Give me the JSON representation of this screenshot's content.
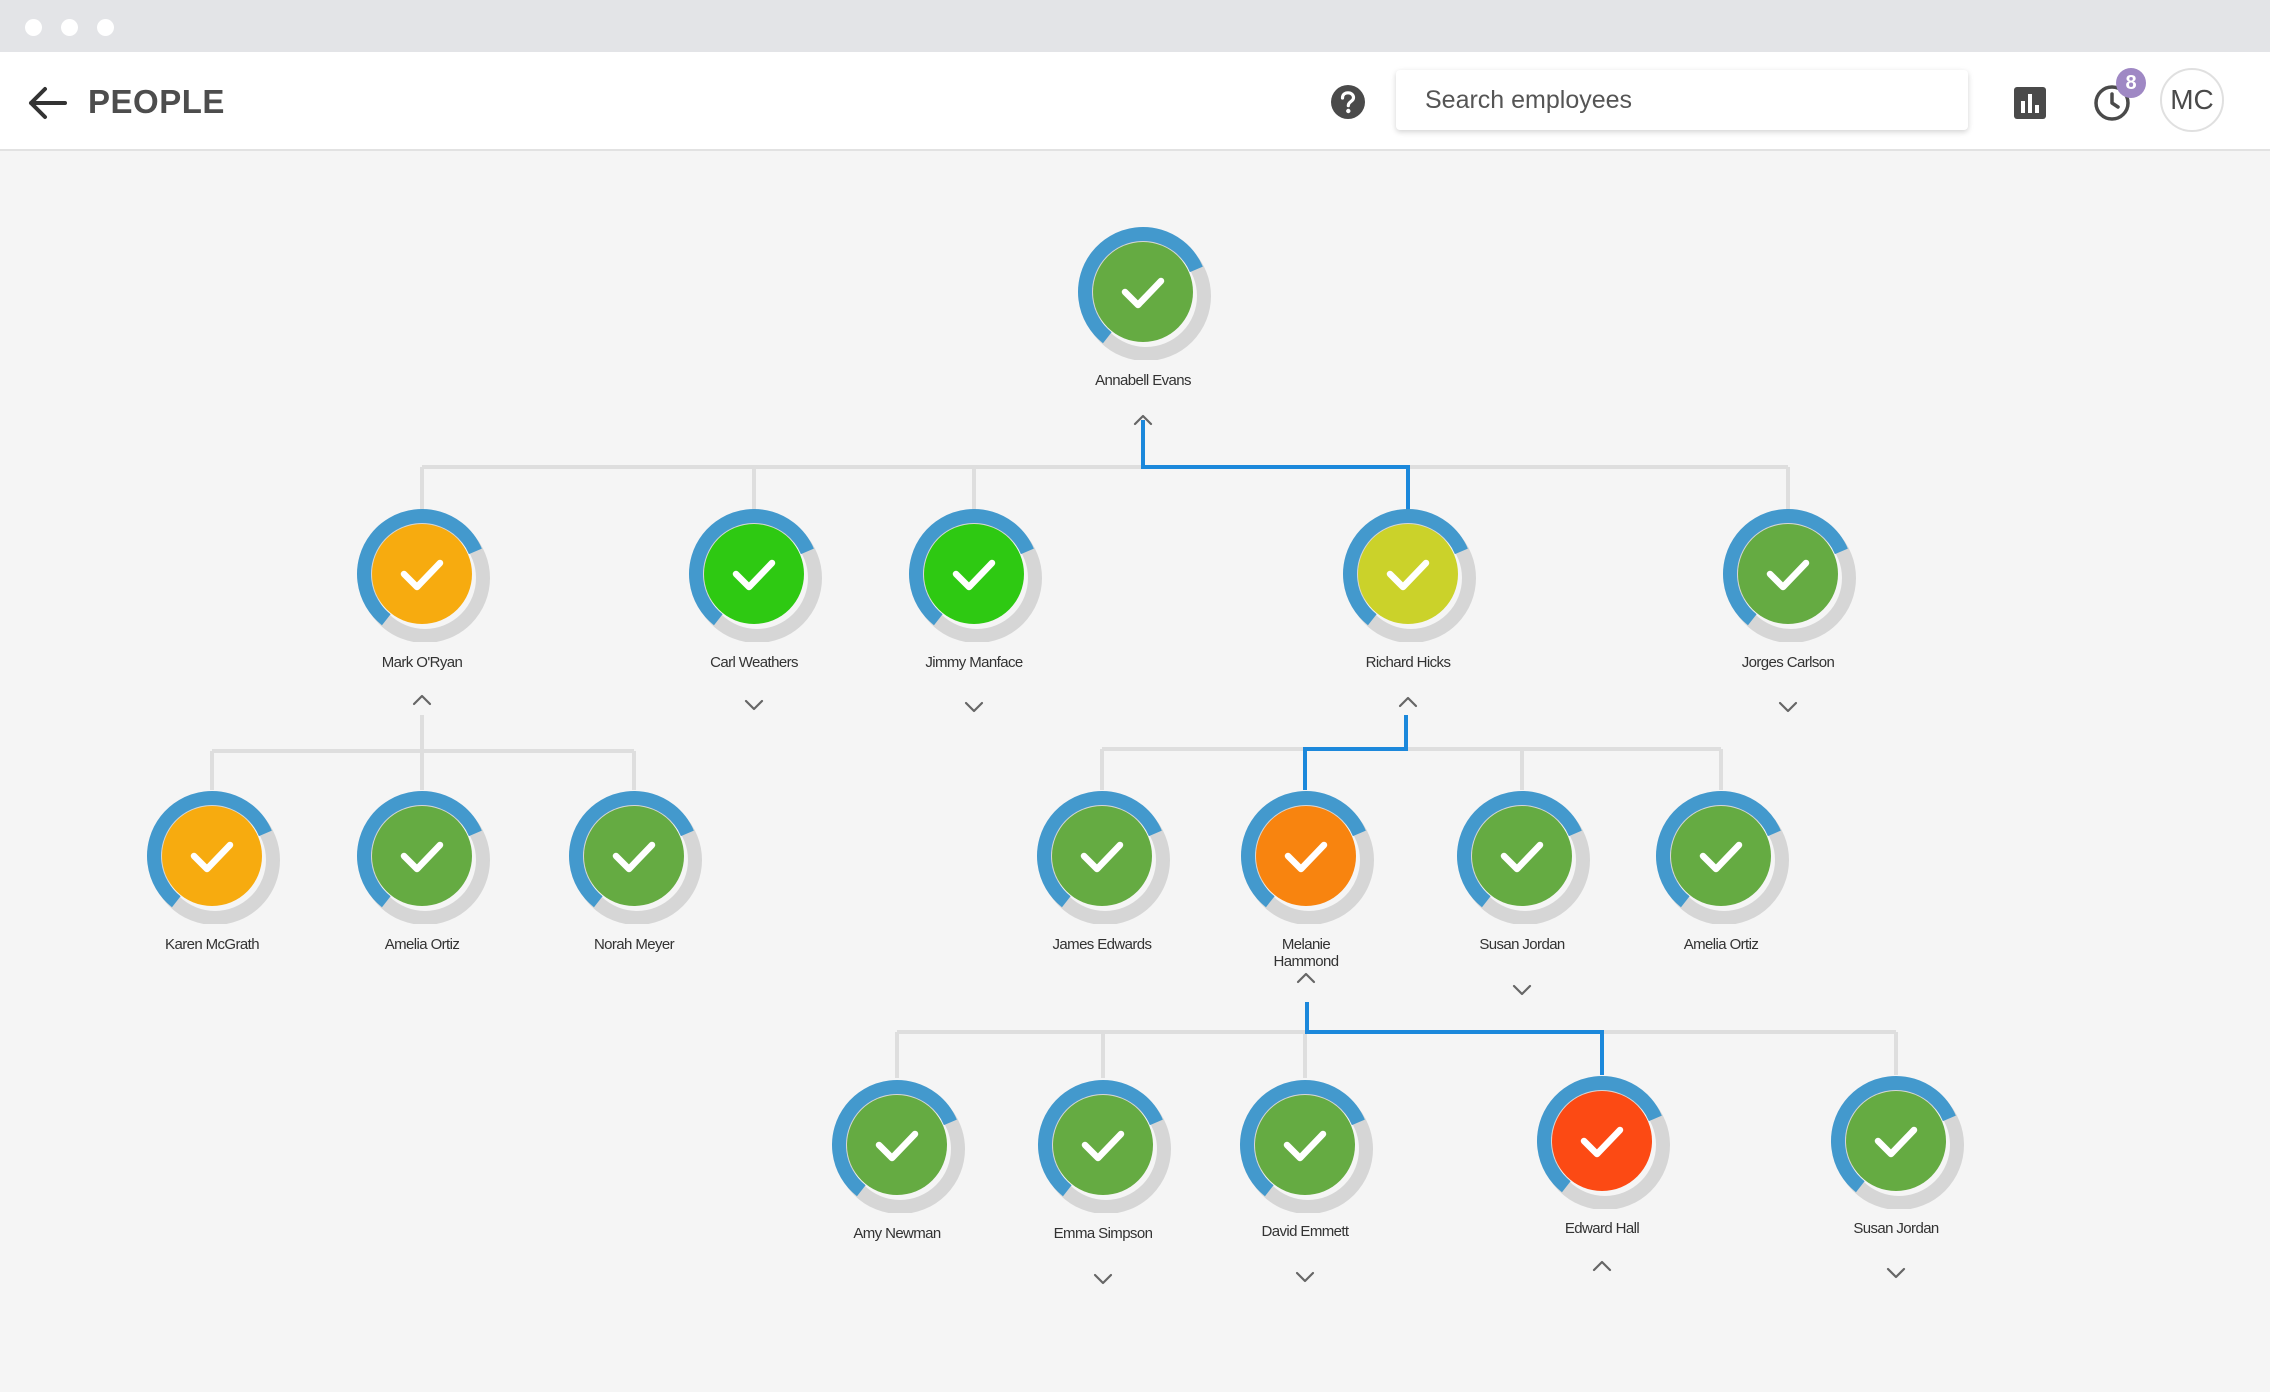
{
  "header": {
    "title": "PEOPLE",
    "search_placeholder": "Search employees",
    "notification_count": "8",
    "user_initials": "MC"
  },
  "icons": {
    "back": "arrow-left-icon",
    "help": "question-circle-icon",
    "chart": "bar-chart-icon",
    "history": "clock-icon",
    "node_check": "checkmark-icon"
  },
  "colors": {
    "ring_progress": "#4399cd",
    "ring_track": "#d6d6d6",
    "link_default": "#dedede",
    "link_active": "#1c88db"
  },
  "people": [
    {
      "name": "Annabell Evans",
      "color": "#65ab42",
      "toggle": "up"
    },
    {
      "name": "Mark O'Ryan",
      "color": "#f7ab0f",
      "toggle": "up"
    },
    {
      "name": "Carl Weathers",
      "color": "#2ec912",
      "toggle": "down"
    },
    {
      "name": "Jimmy Manface",
      "color": "#2ec912",
      "toggle": "down"
    },
    {
      "name": "Richard Hicks",
      "color": "#cbd22a",
      "toggle": "up"
    },
    {
      "name": "Jorges Carlson",
      "color": "#65ab42",
      "toggle": "down"
    },
    {
      "name": "Karen McGrath",
      "color": "#f7ab0f",
      "toggle": ""
    },
    {
      "name": "Amelia Ortiz",
      "color": "#65ab42",
      "toggle": ""
    },
    {
      "name": "Norah Meyer",
      "color": "#65ab42",
      "toggle": ""
    },
    {
      "name": "James Edwards",
      "color": "#65ab42",
      "toggle": ""
    },
    {
      "name": "Melanie Hammond",
      "color": "#f8840f",
      "toggle": "up"
    },
    {
      "name": "Susan Jordan",
      "color": "#65ab42",
      "toggle": "down"
    },
    {
      "name": "Amelia Ortiz",
      "color": "#65ab42",
      "toggle": ""
    },
    {
      "name": "Amy Newman",
      "color": "#65ab42",
      "toggle": ""
    },
    {
      "name": "Emma Simpson",
      "color": "#65ab42",
      "toggle": "down"
    },
    {
      "name": "David Emmett",
      "color": "#65ab42",
      "toggle": "down"
    },
    {
      "name": "Edward Hall",
      "color": "#fc4a14",
      "toggle": "up"
    },
    {
      "name": "Susan Jordan",
      "color": "#65ab42",
      "toggle": "down"
    }
  ]
}
